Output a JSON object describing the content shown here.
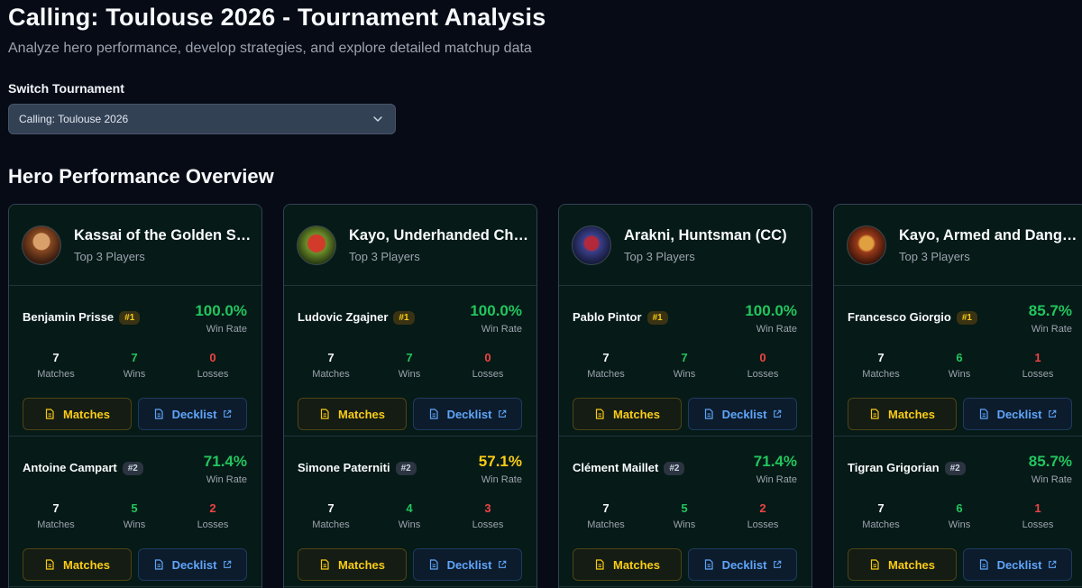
{
  "header": {
    "title": "Calling: Toulouse 2026 - Tournament Analysis",
    "subtitle": "Analyze hero performance, develop strategies, and explore detailed matchup data"
  },
  "switcher": {
    "label": "Switch Tournament",
    "selected": "Calling: Toulouse 2026"
  },
  "section": {
    "title": "Hero Performance Overview"
  },
  "labels": {
    "top_players": "Top 3 Players",
    "win_rate": "Win Rate",
    "matches": "Matches",
    "wins": "Wins",
    "losses": "Losses",
    "matches_button": "Matches",
    "decklist_button": "Decklist"
  },
  "colors": {
    "win_high": "#22c55e",
    "win_mid": "#facc15",
    "loss": "#ef4444",
    "matches_accent": "#facc15",
    "decklist_accent": "#60a5fa"
  },
  "icons": {
    "select": "chevron-down-icon",
    "matches": "document-icon",
    "decklist": [
      "document-icon",
      "external-link-icon"
    ]
  },
  "heroes": [
    {
      "name": "Kassai of the Golden Sand",
      "players": [
        {
          "name": "Benjamin Prisse",
          "rank": "#1",
          "win_rate": "100.0%",
          "matches": "7",
          "wins": "7",
          "losses": "0"
        },
        {
          "name": "Antoine Campart",
          "rank": "#2",
          "win_rate": "71.4%",
          "matches": "7",
          "wins": "5",
          "losses": "2"
        }
      ]
    },
    {
      "name": "Kayo, Underhanded Cheat",
      "players": [
        {
          "name": "Ludovic Zgajner",
          "rank": "#1",
          "win_rate": "100.0%",
          "matches": "7",
          "wins": "7",
          "losses": "0"
        },
        {
          "name": "Simone Paterniti",
          "rank": "#2",
          "win_rate": "57.1%",
          "matches": "7",
          "wins": "4",
          "losses": "3"
        }
      ]
    },
    {
      "name": "Arakni, Huntsman (CC)",
      "players": [
        {
          "name": "Pablo Pintor",
          "rank": "#1",
          "win_rate": "100.0%",
          "matches": "7",
          "wins": "7",
          "losses": "0"
        },
        {
          "name": "Clément Maillet",
          "rank": "#2",
          "win_rate": "71.4%",
          "matches": "7",
          "wins": "5",
          "losses": "2"
        }
      ]
    },
    {
      "name": "Kayo, Armed and Dangerous",
      "players": [
        {
          "name": "Francesco Giorgio",
          "rank": "#1",
          "win_rate": "85.7%",
          "matches": "7",
          "wins": "6",
          "losses": "1"
        },
        {
          "name": "Tigran Grigorian",
          "rank": "#2",
          "win_rate": "85.7%",
          "matches": "7",
          "wins": "6",
          "losses": "1"
        }
      ]
    }
  ]
}
